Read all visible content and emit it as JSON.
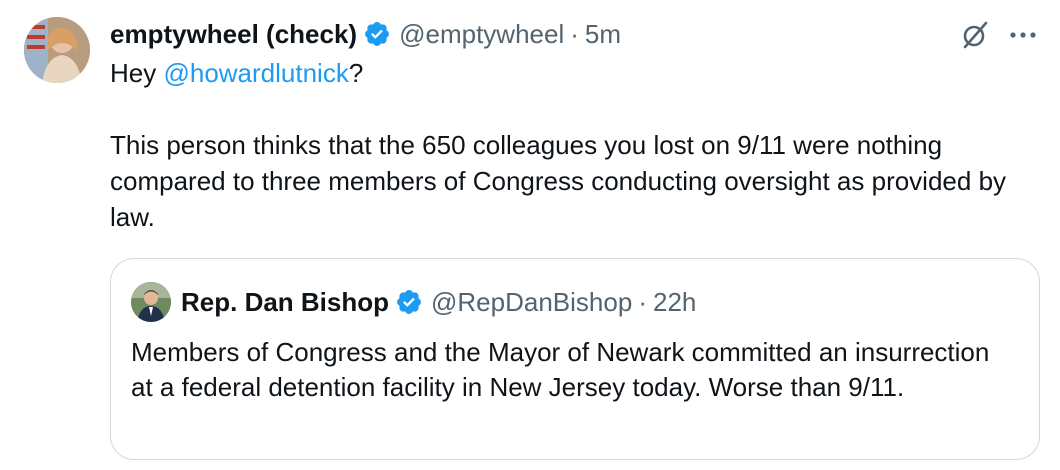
{
  "tweet": {
    "author": {
      "name": "emptywheel (check)",
      "handle": "@emptywheel",
      "time": "5m"
    },
    "text_parts": {
      "greeting": "Hey ",
      "mention": "@howardlutnick",
      "after_mention": "?",
      "paragraph": "This person thinks that the 650 colleagues you lost on 9/11 were nothing compared to three members of Congress conducting oversight as provided by law."
    },
    "separator": "·",
    "actions": {
      "grok_icon": "grok-icon",
      "more_icon": "more-icon"
    }
  },
  "quote": {
    "author": {
      "name": "Rep. Dan Bishop",
      "handle": "@RepDanBishop",
      "time": "22h"
    },
    "separator": "·",
    "text": "Members of Congress and the Mayor of Newark committed an insurrection at a federal detention facility in New Jersey today. Worse than 9/11."
  },
  "colors": {
    "verified_blue": "#1d9bf0",
    "text_primary": "#0f1419",
    "text_secondary": "#536471",
    "border": "#cfd9de"
  }
}
